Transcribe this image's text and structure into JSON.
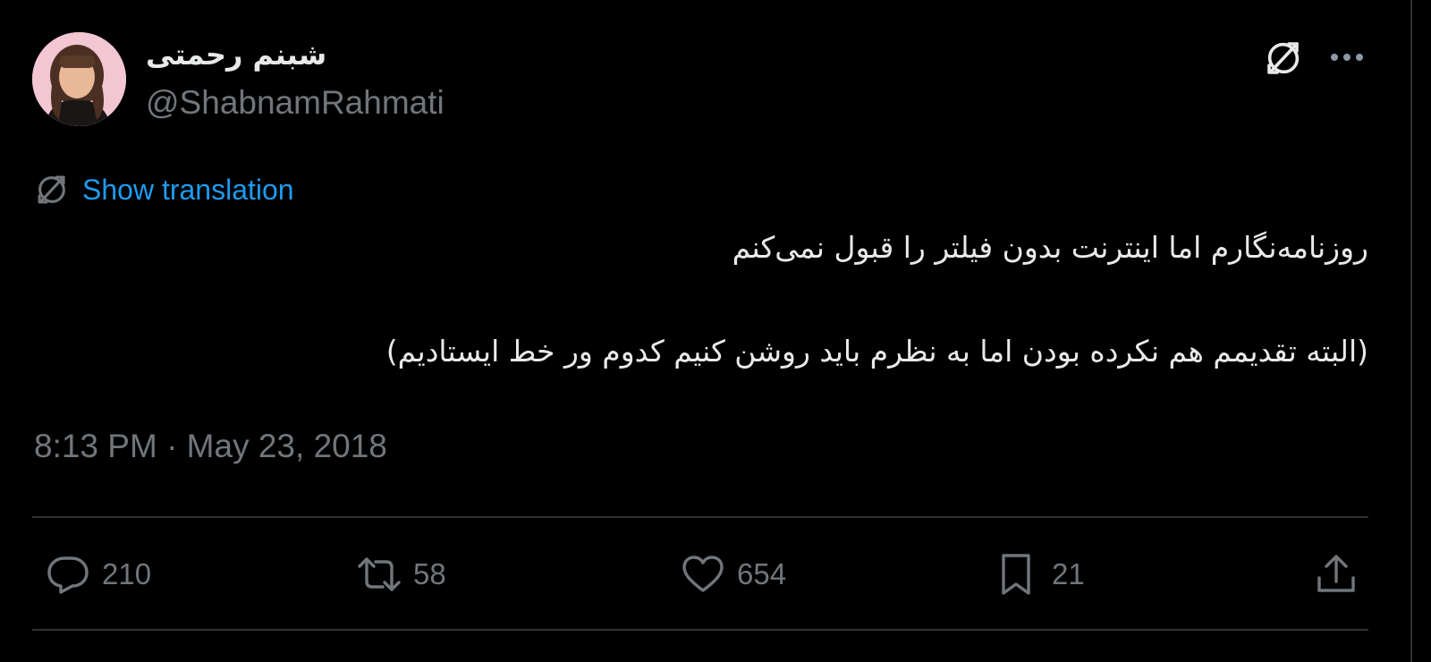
{
  "author": {
    "display_name": "شبنم رحمتی",
    "handle": "@ShabnamRahmati",
    "avatar_icon": "avatar"
  },
  "header_icons": {
    "translate_icon": "translate-icon",
    "more_icon": "more-icon"
  },
  "translation": {
    "label": "Show translation"
  },
  "tweet": {
    "line1": "روزنامه‌نگارم اما اینترنت بدون فیلتر را قبول نمی‌کنم",
    "line2": "(البته تقدیمم هم نکرده بودن اما به نظرم باید روشن کنیم کدوم ور خط ایستادیم)"
  },
  "timestamp": "8:13 PM · May 23, 2018",
  "actions": {
    "reply_count": "210",
    "retweet_count": "58",
    "like_count": "654",
    "bookmark_count": "21"
  },
  "colors": {
    "background": "#000000",
    "primary_text": "#e7e9ea",
    "secondary_text": "#71767b",
    "link": "#1d9bf0",
    "divider": "#2f3336"
  }
}
